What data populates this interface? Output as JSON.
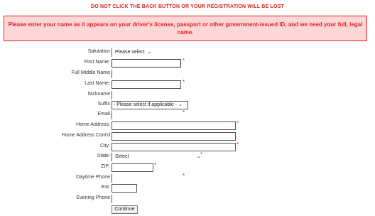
{
  "warning": "DO NOT CLICK THE BACK BUTTON OR YOUR REGISTRATION WILL BE LOST",
  "notice": "Please enter your name as it appears on your driver's license, passport or other government-issued ID, and we need your full, legal name.",
  "required_mark": "*",
  "form": {
    "salutation": {
      "label": "Salutation",
      "value": "Please select"
    },
    "first_name": {
      "label": "First Name:",
      "value": ""
    },
    "middle_name": {
      "label": "Full Middle Name",
      "value": ""
    },
    "last_name": {
      "label": "Last Name:",
      "value": ""
    },
    "nickname": {
      "label": "Nickname",
      "value": ""
    },
    "suffix": {
      "label": "Suffix",
      "value": "- Please select if applicable -"
    },
    "email": {
      "label": "Email",
      "value": ""
    },
    "home_address": {
      "label": "Home Address:",
      "value": ""
    },
    "home_address_cont": {
      "label": "Home Address Cont'd",
      "value": ""
    },
    "city": {
      "label": "City:",
      "value": ""
    },
    "state": {
      "label": "State:",
      "value": "Select"
    },
    "zip": {
      "label": "ZIP:",
      "value": ""
    },
    "daytime_phone": {
      "label": "Daytime Phone",
      "value": ""
    },
    "ext": {
      "label": "Ext:",
      "value": ""
    },
    "evening_phone": {
      "label": "Evening Phone",
      "value": ""
    }
  },
  "continue_label": "Continue"
}
